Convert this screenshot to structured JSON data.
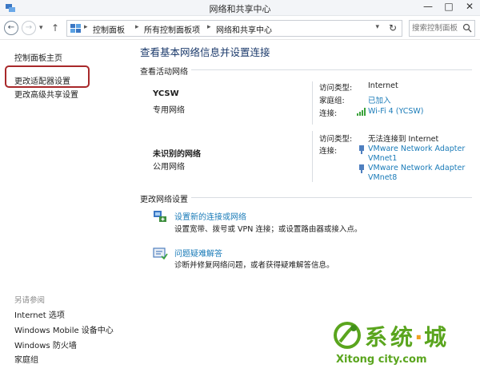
{
  "window": {
    "title": "网络和共享中心",
    "controls": [
      "—",
      "□",
      "✕"
    ]
  },
  "address_bar": {
    "breadcrumbs": [
      "控制面板",
      "所有控制面板项",
      "网络和共享中心"
    ],
    "search_placeholder": "搜索控制面板"
  },
  "sidebar": {
    "items": [
      {
        "label": "控制面板主页"
      },
      {
        "label": "更改适配器设置",
        "highlighted": true
      },
      {
        "label": "更改高级共享设置"
      }
    ],
    "see_also_title": "另请参阅",
    "see_also": [
      "Internet 选项",
      "Windows Mobile 设备中心",
      "Windows 防火墙",
      "家庭组"
    ]
  },
  "main": {
    "heading": "查看基本网络信息并设置连接",
    "active_networks_label": "查看活动网络",
    "networks": [
      {
        "name": "YCSW",
        "type": "专用网络",
        "access_label": "访问类型:",
        "access_value": "Internet",
        "homegroup_label": "家庭组:",
        "homegroup_value": "已加入",
        "connection_label": "连接:",
        "connection_value": "Wi-Fi 4 (YCSW)"
      },
      {
        "name": "未识别的网络",
        "type": "公用网络",
        "access_label": "访问类型:",
        "access_value": "无法连接到 Internet",
        "connection_label": "连接:",
        "connections": [
          {
            "line1": "VMware Network Adapter",
            "line2": "VMnet1"
          },
          {
            "line1": "VMware Network Adapter",
            "line2": "VMnet8"
          }
        ]
      }
    ],
    "change_settings_label": "更改网络设置",
    "tasks": [
      {
        "link": "设置新的连接或网络",
        "description": "设置宽带、拨号或 VPN 连接；或设置路由器或接入点。"
      },
      {
        "link": "问题疑难解答",
        "description": "诊断并修复网络问题，或者获得疑难解答信息。"
      }
    ]
  },
  "watermark": {
    "brand_chars": [
      "系",
      "统",
      "·",
      "城"
    ],
    "url": "Xitong city.com"
  },
  "colors": {
    "heading": "#1b3a6b",
    "link": "#1a7bb8",
    "highlight_box": "#a8282a",
    "watermark_green": "#5aa51e"
  }
}
